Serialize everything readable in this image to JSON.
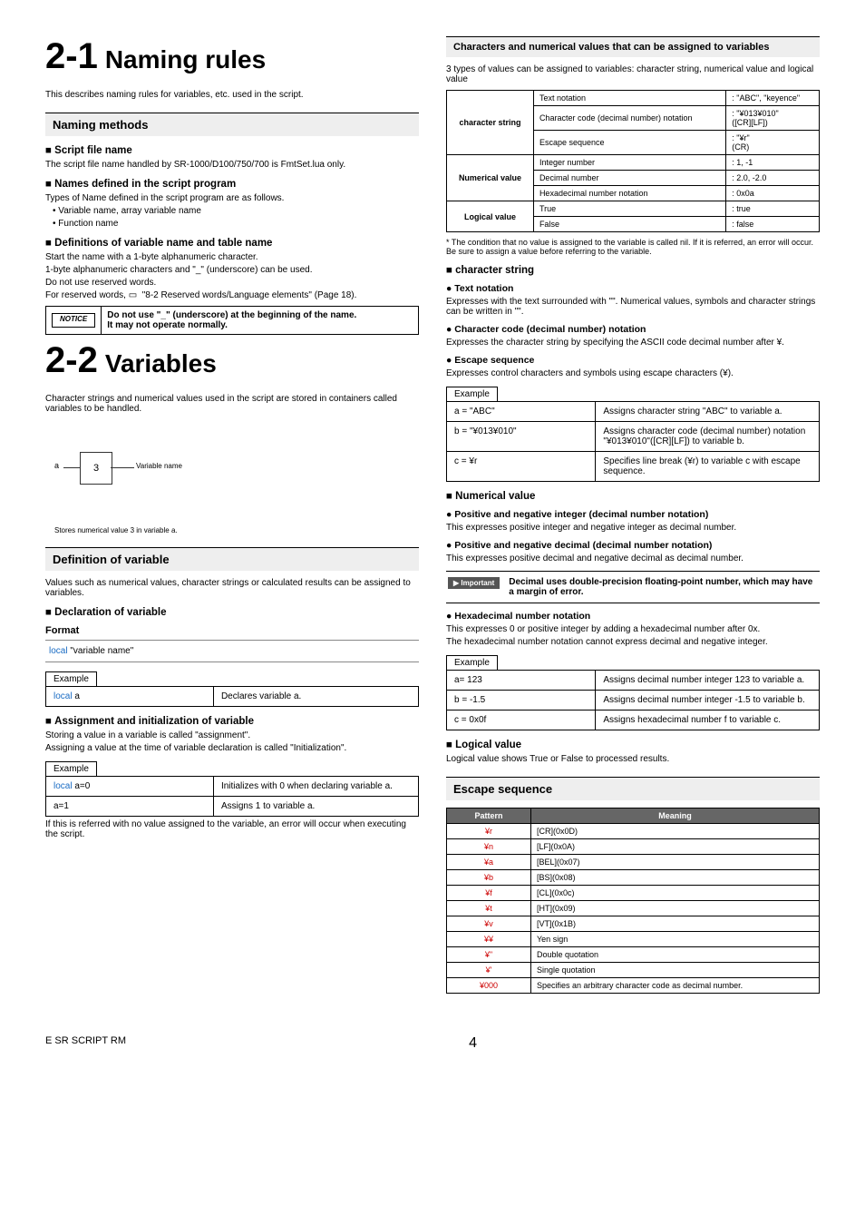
{
  "left": {
    "s21_num": "2-1",
    "s21_title": "Naming rules",
    "s21_intro": "This describes naming rules for variables, etc. used in the script.",
    "h2_naming": "Naming methods",
    "h3_script": "Script file name",
    "p_script": "The script file name handled by SR-1000/D100/750/700 is FmtSet.lua only.",
    "h3_names": "Names defined in the script program",
    "p_names": "Types of Name defined in the script program are as follows.",
    "b1": "Variable name, array variable name",
    "b2": "Function name",
    "h3_defs": "Definitions of variable name and table name",
    "p_d1": "Start the name with a 1-byte alphanumeric character.",
    "p_d2": "1-byte alphanumeric characters and \"_\" (underscore) can be used.",
    "p_d3": "Do not use reserved words.",
    "p_d4a": "For reserved words, ",
    "p_d4b": " \"8-2 Reserved words/Language elements\" (Page 18).",
    "notice_lbl": "NOTICE",
    "notice_l1": "Do not use \"_\" (underscore) at the beginning of the name.",
    "notice_l2": "It may not operate normally.",
    "s22_num": "2-2",
    "s22_title": "Variables",
    "s22_intro": "Character strings and numerical values used in the script are stored in containers called variables to be handled.",
    "dia_val": "3",
    "dia_a": "a",
    "dia_vn": "Variable name",
    "dia_cap": "Stores numerical value 3 in variable a.",
    "h2_defvar": "Definition of variable",
    "p_defvar": "Values such as numerical values, character strings or calculated results can be assigned to variables.",
    "h3_decl": "Declaration of variable",
    "fmt": "Format",
    "fmt_kw": "local",
    "fmt_v": " \"variable name\"",
    "ex": "Example",
    "ex1_c": "local",
    "ex1_v": " a",
    "ex1_d": "Declares variable a.",
    "h3_assign": "Assignment and initialization of variable",
    "p_a1": "Storing a value in a variable is called \"assignment\".",
    "p_a2": "Assigning a value at the time of variable declaration is called \"Initialization\".",
    "ex2_r1c": "local",
    "ex2_r1v": " a=0",
    "ex2_r1d": "Initializes with 0 when declaring variable a.",
    "ex2_r2v": "a=1",
    "ex2_r2d": "Assigns 1 to variable a.",
    "p_err": "If this is referred with no value assigned to the variable, an error will occur when executing the script."
  },
  "right": {
    "h2_chars": "Characters and numerical values that can be assigned to variables",
    "p_chars": "3 types of values can be assigned to variables: character string, numerical value and logical value",
    "def": {
      "r1h": "character string",
      "r1a": "Text notation",
      "r1av": ": \"ABC\", \"keyence\"",
      "r1b": "Character code (decimal number) notation",
      "r1bv1": ": \"¥013¥010\"",
      "r1bv2": "([CR][LF])",
      "r1c": "Escape sequence",
      "r1cv1": ": \"¥r\"",
      "r1cv2": "(CR)",
      "r2h": "Numerical value",
      "r2a": "Integer number",
      "r2av": ": 1, -1",
      "r2b": "Decimal number",
      "r2bv": ": 2.0, -2.0",
      "r2c": "Hexadecimal number notation",
      "r2cv": ": 0x0a",
      "r3h": "Logical value",
      "r3a": "True",
      "r3av": ": true",
      "r3b": "False",
      "r3bv": ": false"
    },
    "star": "* The condition that no value is assigned to the variable is called nil. If it is referred, an error will occur. Be sure to assign a value before referring to the variable.",
    "h3_cs": "character string",
    "h4_tn": "Text notation",
    "p_tn": "Expresses with the text surrounded with \"\". Numerical values, symbols and character strings can be written in \"\".",
    "h4_cc": "Character code (decimal number) notation",
    "p_cc": "Expresses the character string by specifying the ASCII code decimal number after ¥.",
    "h4_es": "Escape sequence",
    "p_es": "Expresses control characters and symbols using escape characters (¥).",
    "ex3_r1v": "a = \"ABC\"",
    "ex3_r1d": "Assigns character string \"ABC\" to variable a.",
    "ex3_r2v": "b = \"¥013¥010\"",
    "ex3_r2d": "Assigns character code (decimal number) notation \"¥013¥010\"([CR][LF]) to variable b.",
    "ex3_r3v": "c = ¥r",
    "ex3_r3d": "Specifies line break (¥r) to variable c with escape sequence.",
    "h3_nv": "Numerical value",
    "h4_pi": "Positive and negative integer (decimal number notation)",
    "p_pi": "This expresses positive integer and negative integer as decimal number.",
    "h4_pd": "Positive and negative decimal (decimal number notation)",
    "p_pd": "This expresses positive decimal and negative decimal as decimal number.",
    "imp_b": "Important",
    "imp_t": "Decimal uses double-precision floating-point number, which may have a margin of error.",
    "h4_hx": "Hexadecimal number notation",
    "p_hx1": "This expresses 0 or positive integer by adding a hexadecimal number after 0x.",
    "p_hx2": "The hexadecimal number notation cannot express decimal and negative integer.",
    "ex4_r1v": "a= 123",
    "ex4_r1d": "Assigns decimal number integer 123 to variable a.",
    "ex4_r2v": "b = -1.5",
    "ex4_r2d": "Assigns decimal number integer -1.5 to variable b.",
    "ex4_r3v": "c = 0x0f",
    "ex4_r3d": "Assigns hexadecimal number f to variable c.",
    "h3_lv": "Logical value",
    "p_lv": "Logical value shows True or False to processed results.",
    "h2_esc": "Escape sequence",
    "esc_h1": "Pattern",
    "esc_h2": "Meaning",
    "esc": [
      {
        "p": "¥r",
        "m": "[CR](0x0D)"
      },
      {
        "p": "¥n",
        "m": "[LF](0x0A)"
      },
      {
        "p": "¥a",
        "m": "[BEL](0x07)"
      },
      {
        "p": "¥b",
        "m": "[BS](0x08)"
      },
      {
        "p": "¥f",
        "m": "[CL](0x0c)"
      },
      {
        "p": "¥t",
        "m": "[HT](0x09)"
      },
      {
        "p": "¥v",
        "m": "[VT](0x1B)"
      },
      {
        "p": "¥¥",
        "m": "Yen sign"
      },
      {
        "p": "¥\"",
        "m": "Double quotation"
      },
      {
        "p": "¥'",
        "m": "Single quotation"
      },
      {
        "p": "¥000",
        "m": "Specifies an arbitrary character code as decimal number."
      }
    ]
  },
  "footer_l": "E SR SCRIPT RM",
  "footer_r": "4"
}
